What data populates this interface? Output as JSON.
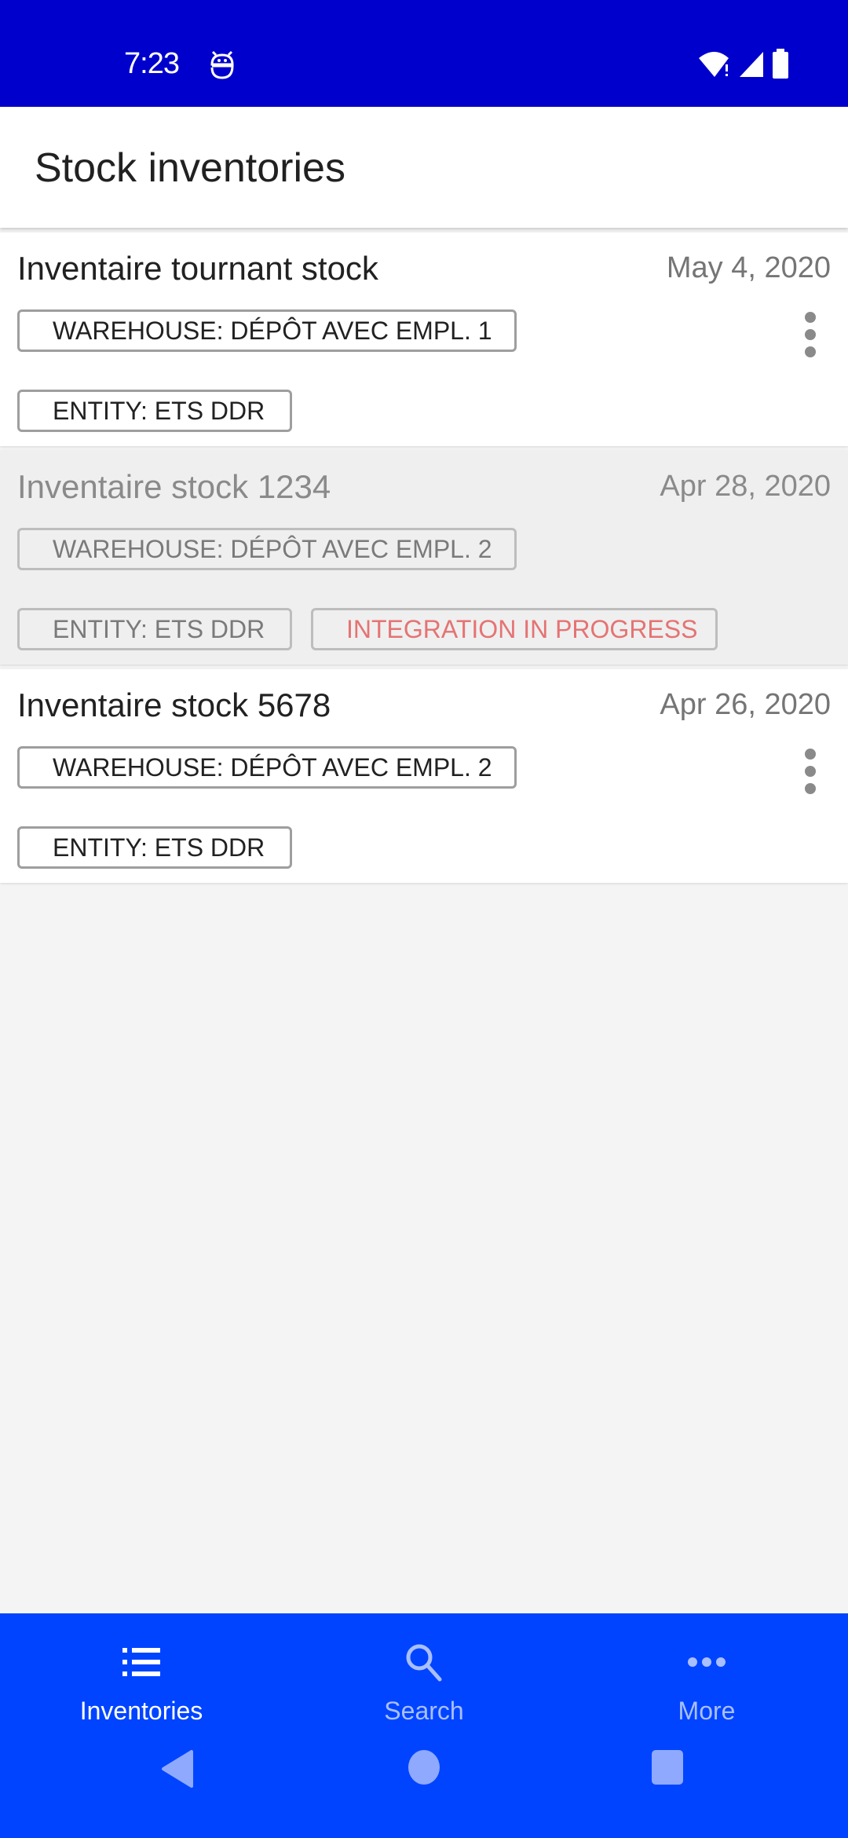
{
  "status_bar": {
    "time": "7:23",
    "icons": [
      "app-notification-icon",
      "wifi-alert-icon",
      "signal-icon",
      "battery-icon"
    ]
  },
  "app_bar": {
    "title": "Stock inventories"
  },
  "inventories": [
    {
      "name": "Inventaire tournant stock",
      "date": "May 4, 2020",
      "warehouse": "WAREHOUSE: DÉPÔT AVEC EMPL. 1",
      "entity": "ENTITY: ETS DDR",
      "status": null,
      "disabled": false
    },
    {
      "name": "Inventaire stock 1234",
      "date": "Apr 28, 2020",
      "warehouse": "WAREHOUSE: DÉPÔT AVEC EMPL. 2",
      "entity": "ENTITY: ETS DDR",
      "status": "INTEGRATION IN PROGRESS",
      "disabled": true
    },
    {
      "name": "Inventaire stock 5678",
      "date": "Apr 26, 2020",
      "warehouse": "WAREHOUSE: DÉPÔT AVEC EMPL. 2",
      "entity": "ENTITY: ETS DDR",
      "status": null,
      "disabled": false
    }
  ],
  "bottom_nav": {
    "items": [
      {
        "label": "Inventories",
        "icon": "list-icon",
        "active": true
      },
      {
        "label": "Search",
        "icon": "search-icon",
        "active": false
      },
      {
        "label": "More",
        "icon": "more-horizontal-icon",
        "active": false
      }
    ]
  },
  "colors": {
    "status_bar": "#0000cc",
    "bottom_nav": "#0044ff",
    "status_chip_text": "#e57373"
  }
}
